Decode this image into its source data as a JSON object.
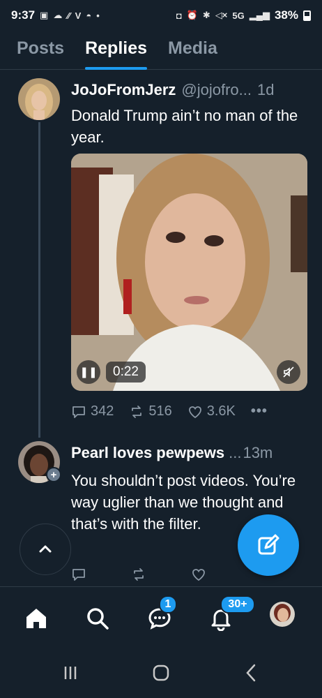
{
  "status_bar": {
    "time": "9:37",
    "network": "5G",
    "battery": "38%",
    "icons_left": [
      "gallery-icon",
      "cloud-icon",
      "wifi-calling-icon",
      "v-icon",
      "messenger-icon",
      "dot-icon"
    ],
    "icons_right": [
      "nfc-icon",
      "alarm-icon",
      "bluetooth-icon",
      "mute-icon",
      "signal-icon",
      "battery-icon"
    ]
  },
  "tabs": [
    {
      "label": "Posts",
      "active": false
    },
    {
      "label": "Replies",
      "active": true
    },
    {
      "label": "Media",
      "active": false
    }
  ],
  "posts": [
    {
      "display_name": "JoJoFromJerz",
      "handle": "@jojofro...",
      "time": "1d",
      "text": "Donald Trump ain’t no man of the year.",
      "video": {
        "duration": "0:22"
      },
      "actions": {
        "replies": "342",
        "reposts": "516",
        "likes": "3.6K"
      }
    },
    {
      "display_name": "Pearl loves pewpews",
      "handle": "...",
      "time": "13m",
      "text": "You shouldn’t post videos. You’re way uglier than we thought and that’s with the filter.",
      "actions": {
        "replies": "",
        "reposts": "",
        "likes": ""
      }
    }
  ],
  "bottom_nav": {
    "items": [
      "home",
      "search",
      "messages",
      "notifications",
      "profile"
    ],
    "messages_badge": "1",
    "notifications_badge": "30+"
  },
  "colors": {
    "background": "#15202b",
    "accent": "#1d9bf0",
    "muted": "#8b98a5"
  }
}
